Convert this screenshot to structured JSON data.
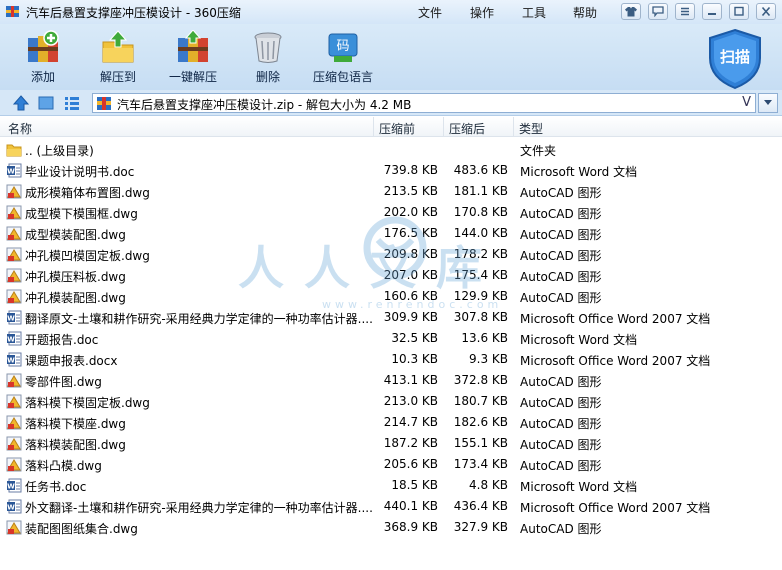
{
  "window": {
    "title": "汽车后悬置支撑座冲压模设计 - 360压缩",
    "menu": [
      "文件",
      "操作",
      "工具",
      "帮助"
    ]
  },
  "toolbar": {
    "buttons": [
      {
        "label": "添加",
        "icon": "add-books-icon"
      },
      {
        "label": "解压到",
        "icon": "extract-to-icon"
      },
      {
        "label": "一键解压",
        "icon": "one-click-extract-icon"
      },
      {
        "label": "删除",
        "icon": "trash-can-icon"
      },
      {
        "label": "压缩包语言",
        "icon": "archive-language-icon"
      }
    ],
    "extract_badge": "码",
    "scan_label": "扫描"
  },
  "address": {
    "text": "汽车后悬置支撑座冲压模设计.zip - 解包大小为 4.2 MB",
    "dropdown_glyph": "V"
  },
  "columns": {
    "name": "名称",
    "size": "压缩前",
    "compressed": "压缩后",
    "type": "类型"
  },
  "files": [
    {
      "name": ".. (上级目录)",
      "size": "",
      "compressed": "",
      "type": "文件夹",
      "icon": "folder"
    },
    {
      "name": "毕业设计说明书.doc",
      "size": "739.8 KB",
      "compressed": "483.6 KB",
      "type": "Microsoft Word 文档",
      "icon": "word"
    },
    {
      "name": "成形模箱体布置图.dwg",
      "size": "213.5 KB",
      "compressed": "181.1 KB",
      "type": "AutoCAD 图形",
      "icon": "dwg"
    },
    {
      "name": "成型模下模围框.dwg",
      "size": "202.0 KB",
      "compressed": "170.8 KB",
      "type": "AutoCAD 图形",
      "icon": "dwg"
    },
    {
      "name": "成型模装配图.dwg",
      "size": "176.5 KB",
      "compressed": "144.0 KB",
      "type": "AutoCAD 图形",
      "icon": "dwg"
    },
    {
      "name": "冲孔模凹模固定板.dwg",
      "size": "209.8 KB",
      "compressed": "178.2 KB",
      "type": "AutoCAD 图形",
      "icon": "dwg"
    },
    {
      "name": "冲孔模压料板.dwg",
      "size": "207.0 KB",
      "compressed": "175.4 KB",
      "type": "AutoCAD 图形",
      "icon": "dwg"
    },
    {
      "name": "冲孔模装配图.dwg",
      "size": "160.6 KB",
      "compressed": "129.9 KB",
      "type": "AutoCAD 图形",
      "icon": "dwg"
    },
    {
      "name": "翻译原文-土壤和耕作研究-采用经典力学定律的一种功率估计器....",
      "size": "309.9 KB",
      "compressed": "307.8 KB",
      "type": "Microsoft Office Word 2007 文档",
      "icon": "word"
    },
    {
      "name": "开题报告.doc",
      "size": "32.5 KB",
      "compressed": "13.6 KB",
      "type": "Microsoft Word 文档",
      "icon": "word"
    },
    {
      "name": "课题申报表.docx",
      "size": "10.3 KB",
      "compressed": "9.3 KB",
      "type": "Microsoft Office Word 2007 文档",
      "icon": "word"
    },
    {
      "name": "零部件图.dwg",
      "size": "413.1 KB",
      "compressed": "372.8 KB",
      "type": "AutoCAD 图形",
      "icon": "dwg"
    },
    {
      "name": "落料模下模固定板.dwg",
      "size": "213.0 KB",
      "compressed": "180.7 KB",
      "type": "AutoCAD 图形",
      "icon": "dwg"
    },
    {
      "name": "落料模下模座.dwg",
      "size": "214.7 KB",
      "compressed": "182.6 KB",
      "type": "AutoCAD 图形",
      "icon": "dwg"
    },
    {
      "name": "落料模装配图.dwg",
      "size": "187.2 KB",
      "compressed": "155.1 KB",
      "type": "AutoCAD 图形",
      "icon": "dwg"
    },
    {
      "name": "落料凸模.dwg",
      "size": "205.6 KB",
      "compressed": "173.4 KB",
      "type": "AutoCAD 图形",
      "icon": "dwg"
    },
    {
      "name": "任务书.doc",
      "size": "18.5 KB",
      "compressed": "4.8 KB",
      "type": "Microsoft Word 文档",
      "icon": "word"
    },
    {
      "name": "外文翻译-土壤和耕作研究-采用经典力学定律的一种功率估计器....",
      "size": "440.1 KB",
      "compressed": "436.4 KB",
      "type": "Microsoft Office Word 2007 文档",
      "icon": "word"
    },
    {
      "name": "装配图图纸集合.dwg",
      "size": "368.9 KB",
      "compressed": "327.9 KB",
      "type": "AutoCAD 图形",
      "icon": "dwg"
    }
  ],
  "watermark": {
    "text": "人人文库",
    "url": "www.renrendoc.com"
  }
}
